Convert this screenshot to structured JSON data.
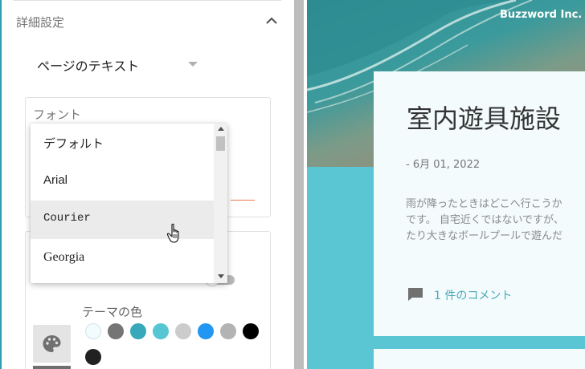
{
  "settings": {
    "section_title": "詳細設定",
    "page_select": {
      "label": "ページのテキスト"
    },
    "font_field": {
      "label": "フォント"
    },
    "theme_color_label": "テーマの色",
    "swatches": [
      "#f2fbfd",
      "#757575",
      "#37a9bb",
      "#56c6d2",
      "#cccccc",
      "#2196f3",
      "#b3b3b3",
      "#000000",
      "#212121"
    ]
  },
  "dropdown": {
    "options": [
      "デフォルト",
      "Arial",
      "Courier",
      "Georgia"
    ],
    "hovered_option": "Courier"
  },
  "preview": {
    "brand": "Buzzword Inc.",
    "post_title": "室内遊具施設",
    "post_date": "- 6月 01, 2022",
    "post_body_lines": [
      "雨が降ったときはどこへ行こうか",
      "です。 自宅近くではないですが、",
      "たり大きなボールプールで遊んだ"
    ],
    "comment_link": "1 件のコメント"
  }
}
